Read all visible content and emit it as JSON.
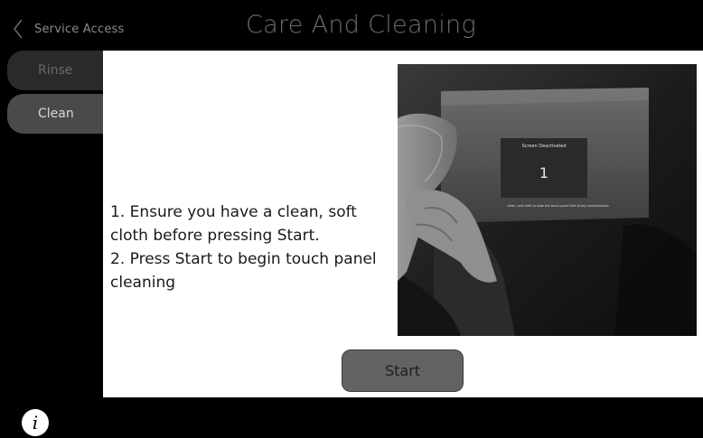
{
  "header": {
    "back_label": "Service Access",
    "title": "Care And Cleaning"
  },
  "sidebar": {
    "items": [
      {
        "label": "Rinse",
        "selected": false
      },
      {
        "label": "Clean",
        "selected": true
      }
    ]
  },
  "main": {
    "instructions": [
      "1. Ensure you have a clean, soft cloth before pressing Start.",
      "2. Press Start to begin touch panel cleaning"
    ],
    "photo": {
      "screen_title": "Screen Deactivated",
      "screen_counter": "1",
      "screen_caption": "clean, soft cloth to wipe the touch panel free of any contaminants."
    },
    "start_label": "Start"
  },
  "footer": {
    "info_icon": "info-icon"
  },
  "colors": {
    "background": "#000000",
    "panel": "#ffffff",
    "start_button": "#636363",
    "selected_tab": "#4a4a4a"
  }
}
